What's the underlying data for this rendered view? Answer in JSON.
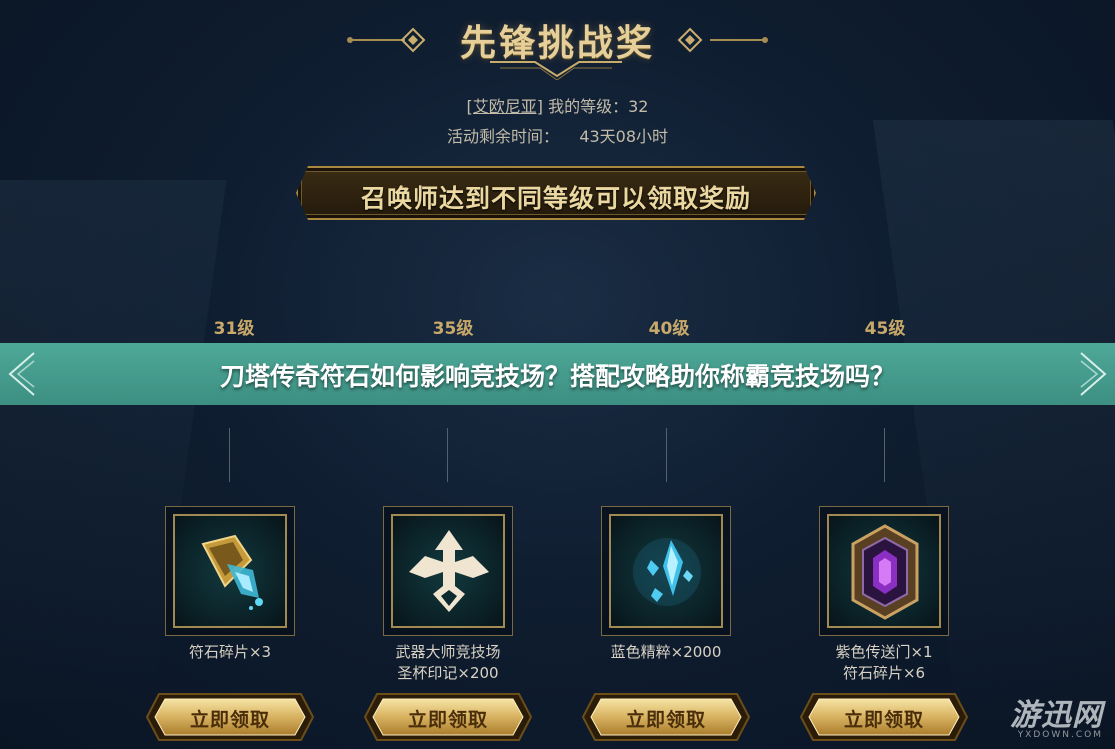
{
  "title": "先锋挑战奖",
  "player": {
    "server": "[艾欧尼亚]",
    "level_label": "我的等级：32",
    "time_label": "活动剩余时间：",
    "time_value": "43天08小时"
  },
  "banner": "召唤师达到不同等级可以领取奖励",
  "overlay": "刀塔传奇符石如何影响竞技场？搭配攻略助你称霸竞技场吗？",
  "rewards": [
    {
      "level": "31级",
      "line1": "符石碎片×3",
      "line2": "",
      "icon": "rune-shard-icon",
      "button": "立即领取"
    },
    {
      "level": "35级",
      "line1": "武器大师竞技场",
      "line2": "圣杯印记×200",
      "icon": "fleur-emblem-icon",
      "button": "立即领取"
    },
    {
      "level": "40级",
      "line1": "蓝色精粹×2000",
      "line2": "",
      "icon": "blue-essence-icon",
      "button": "立即领取"
    },
    {
      "level": "45级",
      "line1": "紫色传送门×1",
      "line2": "符石碎片×6",
      "icon": "purple-portal-icon",
      "button": "立即领取"
    }
  ],
  "watermark": {
    "main": "游迅网",
    "sub": "YXDOWN.COM"
  },
  "colors": {
    "gold": "#c8a96a",
    "overlay": "#45998b",
    "background": "#0f1d30"
  }
}
